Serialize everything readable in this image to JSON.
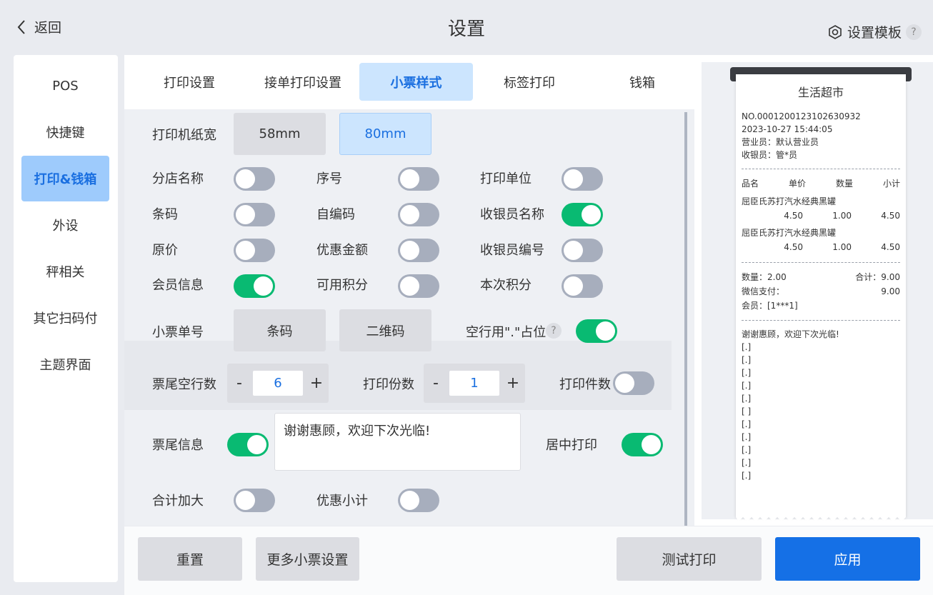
{
  "header": {
    "back_label": "返回",
    "title": "设置",
    "template_label": "设置模板",
    "help": "?"
  },
  "sidebar": {
    "items": [
      {
        "label": "POS"
      },
      {
        "label": "快捷键"
      },
      {
        "label": "打印&钱箱",
        "active": true
      },
      {
        "label": "外设"
      },
      {
        "label": "秤相关"
      },
      {
        "label": "其它扫码付"
      },
      {
        "label": "主题界面"
      }
    ]
  },
  "tabs": [
    {
      "label": "打印设置"
    },
    {
      "label": "接单打印设置"
    },
    {
      "label": "小票样式",
      "active": true
    },
    {
      "label": "标签打印"
    },
    {
      "label": "钱箱"
    }
  ],
  "form": {
    "paper_width": {
      "label": "打印机纸宽",
      "options": [
        "58mm",
        "80mm"
      ],
      "selected": "80mm"
    },
    "toggles": {
      "branch_name": {
        "label": "分店名称",
        "on": false
      },
      "serial_no": {
        "label": "序号",
        "on": false
      },
      "print_unit": {
        "label": "打印单位",
        "on": false
      },
      "barcode": {
        "label": "条码",
        "on": false
      },
      "self_code": {
        "label": "自编码",
        "on": false
      },
      "cashier_name": {
        "label": "收银员名称",
        "on": true
      },
      "original_price": {
        "label": "原价",
        "on": false
      },
      "discount_amount": {
        "label": "优惠金额",
        "on": false
      },
      "cashier_no": {
        "label": "收银员编号",
        "on": false
      },
      "member_info": {
        "label": "会员信息",
        "on": true
      },
      "available_points": {
        "label": "可用积分",
        "on": false
      },
      "current_points": {
        "label": "本次积分",
        "on": false
      },
      "blank_placeholder": {
        "label": "空行用\".\"占位",
        "on": true
      },
      "print_count": {
        "label": "打印件数",
        "on": false
      },
      "footer_info": {
        "label": "票尾信息",
        "on": true
      },
      "center_print": {
        "label": "居中打印",
        "on": true
      },
      "total_enlarge": {
        "label": "合计加大",
        "on": false
      },
      "discount_subtotal": {
        "label": "优惠小计",
        "on": false
      }
    },
    "receipt_no": {
      "label": "小票单号",
      "options": [
        "条码",
        "二维码"
      ]
    },
    "footer_blank_lines": {
      "label": "票尾空行数",
      "value": "6",
      "minus": "-",
      "plus": "+"
    },
    "copies": {
      "label": "打印份数",
      "value": "1",
      "minus": "-",
      "plus": "+"
    },
    "footer_text": "谢谢惠顾，欢迎下次光临!",
    "help": "?"
  },
  "receipt": {
    "store": "生活超市",
    "no": "NO.0001200123102630932",
    "datetime": "2023-10-27 15:44:05",
    "salesperson": "营业员：默认营业员",
    "cashier": "收银员：管*员",
    "headers": [
      "品名",
      "单价",
      "数量",
      "小计"
    ],
    "items": [
      {
        "name": "屈臣氏苏打汽水经典黑罐",
        "price": "4.50",
        "qty": "1.00",
        "subtotal": "4.50"
      },
      {
        "name": "屈臣氏苏打汽水经典黑罐",
        "price": "4.50",
        "qty": "1.00",
        "subtotal": "4.50"
      }
    ],
    "qty_total": "数量：2.00",
    "sum_total": "合计：9.00",
    "pay_label": "微信支付：",
    "pay_value": "9.00",
    "member": "会员：[1***1]",
    "thanks": "谢谢惠顾，欢迎下次光临!",
    "blank_lines": [
      "[.]",
      "[.]",
      "[.]",
      "[.]",
      "[.]",
      "[ ]",
      "[.]",
      "[.]",
      "[.]",
      "[.]",
      "[.]"
    ]
  },
  "bottom": {
    "reset": "重置",
    "more": "更多小票设置",
    "test_print": "测试打印",
    "apply": "应用"
  },
  "colors": {
    "accent": "#1570e6",
    "toggle_on": "#09ba72",
    "toggle_off": "#a7aebd",
    "selected_bg": "#cce5fe"
  }
}
